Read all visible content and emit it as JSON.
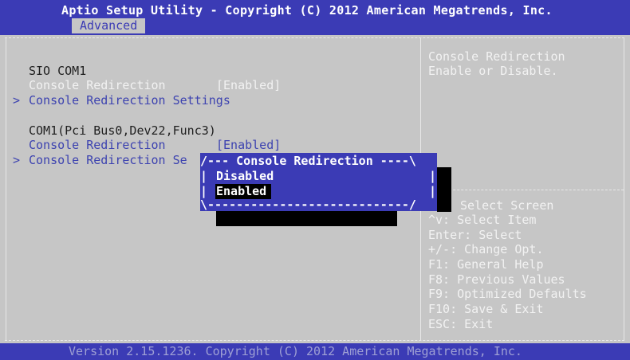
{
  "header": {
    "title": "Aptio Setup Utility - Copyright (C) 2012 American Megatrends, Inc.",
    "active_tab": "Advanced"
  },
  "main": {
    "section1_title": "SIO COM1",
    "section1_item1_label": "Console Redirection",
    "section1_item1_value": "[Enabled]",
    "section1_item2_marker": ">",
    "section1_item2_label": "Console Redirection Settings",
    "section2_title": "COM1(Pci Bus0,Dev22,Func3)",
    "section2_item1_label": "Console Redirection",
    "section2_item1_value": "[Enabled]",
    "section2_item2_marker": ">",
    "section2_item2_label": "Console Redirection Se"
  },
  "help_panel": {
    "line1": "Console Redirection",
    "line2": "Enable or Disable."
  },
  "key_help": {
    "select_screen": "Select Screen",
    "select_item": "^v: Select Item",
    "enter": "Enter: Select",
    "change": "+/-: Change Opt.",
    "f1": "F1: General Help",
    "f8": "F8: Previous Values",
    "f9": "F9: Optimized Defaults",
    "f10": "F10: Save & Exit",
    "esc": "ESC: Exit"
  },
  "dialog": {
    "top_border": "/--- Console Redirection ----\\",
    "bottom_border": "\\----------------------------/",
    "options": [
      "Disabled",
      "Enabled"
    ],
    "selected": "Enabled"
  },
  "footer": {
    "version": "Version 2.15.1236. Copyright (C) 2012 American Megatrends, Inc."
  },
  "colors": {
    "header_bg": "#3b3bb5",
    "body_bg": "#c6c6c6",
    "highlight_text": "#ffffff",
    "item_text": "#3d43b0"
  }
}
